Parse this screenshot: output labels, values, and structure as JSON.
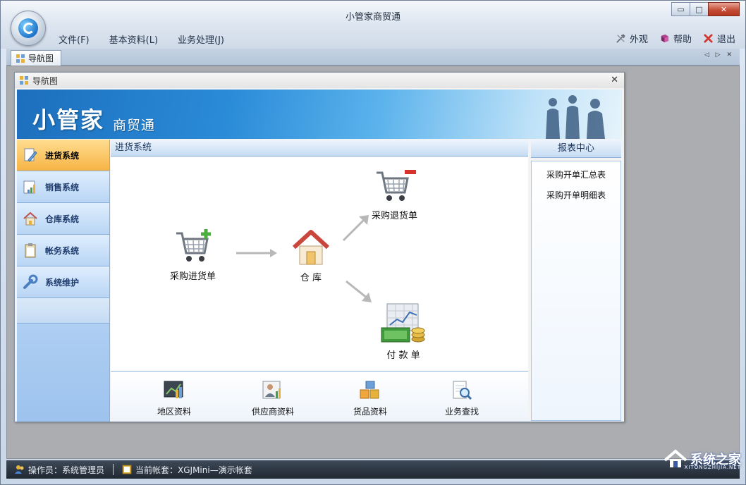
{
  "window": {
    "title": "小管家商贸通",
    "min_label": "▭",
    "restore_label": "□",
    "close_label": "✕"
  },
  "menu": {
    "file": "文件(F)",
    "basic_data": "基本资料(L)",
    "business": "业务处理(J)",
    "appearance": "外观",
    "help": "帮助",
    "exit": "退出"
  },
  "doc_tab": {
    "label": "导航图",
    "nav_arrows": "◁ ▷ ✕"
  },
  "nav_window": {
    "title": "导航图",
    "close_label": "✕"
  },
  "banner": {
    "brand": "小管家",
    "brand_sub": "商贸通"
  },
  "sidebar": {
    "items": [
      {
        "label": "进货系统",
        "icon": "pencil-document-icon",
        "active": true
      },
      {
        "label": "销售系统",
        "icon": "bar-chart-icon",
        "active": false
      },
      {
        "label": "仓库系统",
        "icon": "house-icon",
        "active": false
      },
      {
        "label": "帐务系统",
        "icon": "clipboard-icon",
        "active": false
      },
      {
        "label": "系统维护",
        "icon": "wrench-icon",
        "active": false
      }
    ]
  },
  "main": {
    "header": "进货系统",
    "flow": {
      "purchase": "采购进货单",
      "warehouse": "仓 库",
      "purchase_return": "采购退货单",
      "payment": "付 款 单"
    },
    "quick": [
      {
        "label": "地区资料",
        "icon": "map-chart-icon"
      },
      {
        "label": "供应商资料",
        "icon": "supplier-chart-icon"
      },
      {
        "label": "货品资料",
        "icon": "cubes-icon"
      },
      {
        "label": "业务查找",
        "icon": "document-search-icon"
      }
    ]
  },
  "reports": {
    "header": "报表中心",
    "links": [
      "采购开单汇总表",
      "采购开单明细表"
    ]
  },
  "status": {
    "operator": "操作员：系统管理员",
    "account": "当前帐套：XGJMini—演示帐套"
  },
  "watermark": {
    "text": "系统之家",
    "sub": "XITONGZHIJIA.NET"
  },
  "colors": {
    "accent_active": "#f7b445",
    "banner_blue": "#2a8bd8",
    "status_bg": "#1f2731"
  }
}
